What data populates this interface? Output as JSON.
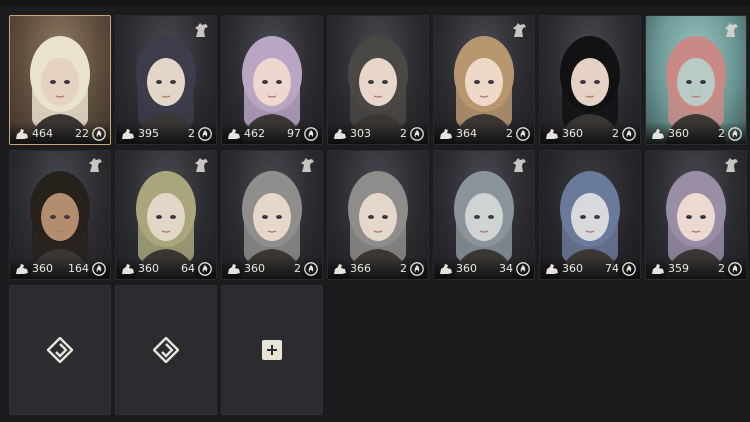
{
  "characters": [
    {
      "level": "464",
      "count": "22",
      "selected": true,
      "hair": "#e9e2cf",
      "skin": "#e6d3bf",
      "bg": "selected",
      "horse": false,
      "icons": {
        "gear": "gear-stat-icon",
        "flame": "flame-icon"
      }
    },
    {
      "level": "395",
      "count": "2",
      "selected": false,
      "hair": "#3d3c4a",
      "skin": "#e3d6c9",
      "bg": "",
      "horse": true
    },
    {
      "level": "462",
      "count": "97",
      "selected": false,
      "hair": "#b9a6c4",
      "skin": "#ecd8cf",
      "bg": "",
      "horse": false
    },
    {
      "level": "303",
      "count": "2",
      "selected": false,
      "hair": "#4a4845",
      "skin": "#e8d6c8",
      "bg": "",
      "horse": false
    },
    {
      "level": "364",
      "count": "2",
      "selected": false,
      "hair": "#b89670",
      "skin": "#eed9c8",
      "bg": "",
      "horse": true
    },
    {
      "level": "360",
      "count": "2",
      "selected": false,
      "hair": "#121214",
      "skin": "#e5d2c4",
      "bg": "",
      "horse": false
    },
    {
      "level": "360",
      "count": "2",
      "selected": false,
      "hair": "#c98a86",
      "skin": "#b9cbc6",
      "bg": "bg-teal",
      "horse": true
    },
    {
      "level": "360",
      "count": "164",
      "selected": false,
      "hair": "#27211c",
      "skin": "#b48c6e",
      "bg": "",
      "horse": true
    },
    {
      "level": "360",
      "count": "64",
      "selected": false,
      "hair": "#a9a67c",
      "skin": "#e2d6c6",
      "bg": "",
      "horse": true
    },
    {
      "level": "360",
      "count": "2",
      "selected": false,
      "hair": "#8f8e8c",
      "skin": "#e6d7cb",
      "bg": "",
      "horse": true
    },
    {
      "level": "366",
      "count": "2",
      "selected": false,
      "hair": "#8e8d8b",
      "skin": "#e6d7cb",
      "bg": "",
      "horse": false
    },
    {
      "level": "360",
      "count": "34",
      "selected": false,
      "hair": "#8a949a",
      "skin": "#cfd3d4",
      "bg": "",
      "horse": true
    },
    {
      "level": "360",
      "count": "74",
      "selected": false,
      "hair": "#6a7a9a",
      "skin": "#d8d9dc",
      "bg": "bg-dark",
      "horse": false
    },
    {
      "level": "359",
      "count": "2",
      "selected": false,
      "hair": "#9a8ea6",
      "skin": "#ecd9d2",
      "bg": "",
      "horse": true
    }
  ],
  "slots": [
    {
      "type": "unlocked",
      "icon": "slot-rune-icon"
    },
    {
      "type": "unlocked",
      "icon": "slot-rune-icon"
    },
    {
      "type": "add",
      "icon": "plus-icon"
    }
  ]
}
